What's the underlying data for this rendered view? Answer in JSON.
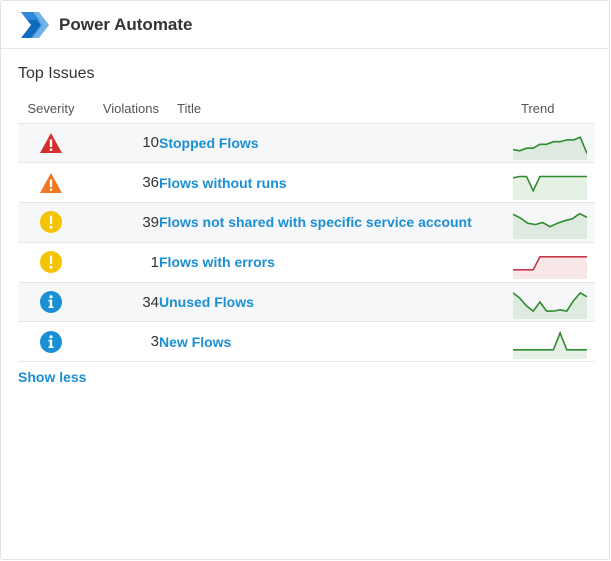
{
  "header": {
    "app_title": "Power Automate",
    "logo_icon": "power-automate-logo"
  },
  "section": {
    "title": "Top Issues"
  },
  "table": {
    "columns": [
      "Severity",
      "Violations",
      "Title",
      "Trend"
    ],
    "rows": [
      {
        "severity": "critical-triangle",
        "violations": "10",
        "title": "Stopped Flows",
        "trend_color": "#2e8b2e",
        "trend": [
          0.25,
          0.2,
          0.3,
          0.3,
          0.45,
          0.45,
          0.55,
          0.55,
          0.62,
          0.62,
          0.72,
          0.1
        ]
      },
      {
        "severity": "warning-triangle",
        "violations": "36",
        "title": "Flows without runs",
        "trend_color": "#2e8b2e",
        "trend": [
          0.7,
          0.75,
          0.75,
          0.2,
          0.75,
          0.75,
          0.75,
          0.75,
          0.75,
          0.75,
          0.75,
          0.75
        ]
      },
      {
        "severity": "warning-circle",
        "violations": "39",
        "title": "Flows not shared with specific service account",
        "trend_color": "#2e8b2e",
        "trend": [
          0.8,
          0.65,
          0.45,
          0.4,
          0.48,
          0.32,
          0.45,
          0.55,
          0.62,
          0.82,
          0.68
        ]
      },
      {
        "severity": "warning-circle",
        "violations": "1",
        "title": "Flows with errors",
        "trend_color": "#c9384a",
        "trend": [
          0.2,
          0.2,
          0.2,
          0.2,
          0.7,
          0.7,
          0.7,
          0.7,
          0.7,
          0.7,
          0.7,
          0.7
        ]
      },
      {
        "severity": "info-circle",
        "violations": "34",
        "title": "Unused Flows",
        "trend_color": "#2e8b2e",
        "trend": [
          0.85,
          0.65,
          0.35,
          0.15,
          0.5,
          0.15,
          0.15,
          0.2,
          0.15,
          0.55,
          0.85,
          0.7
        ]
      },
      {
        "severity": "info-circle",
        "violations": "3",
        "title": "New Flows",
        "trend_color": "#2e8b2e",
        "trend": [
          0.2,
          0.2,
          0.2,
          0.2,
          0.2,
          0.2,
          0.2,
          0.85,
          0.2,
          0.2,
          0.2,
          0.2
        ]
      }
    ]
  },
  "footer": {
    "show_less": "Show less"
  },
  "colors": {
    "critical": "#d32f2f",
    "warning_orange": "#ee7722",
    "warning_yellow": "#f5c400",
    "info": "#1b8fd4",
    "link": "#1b8fd4"
  }
}
